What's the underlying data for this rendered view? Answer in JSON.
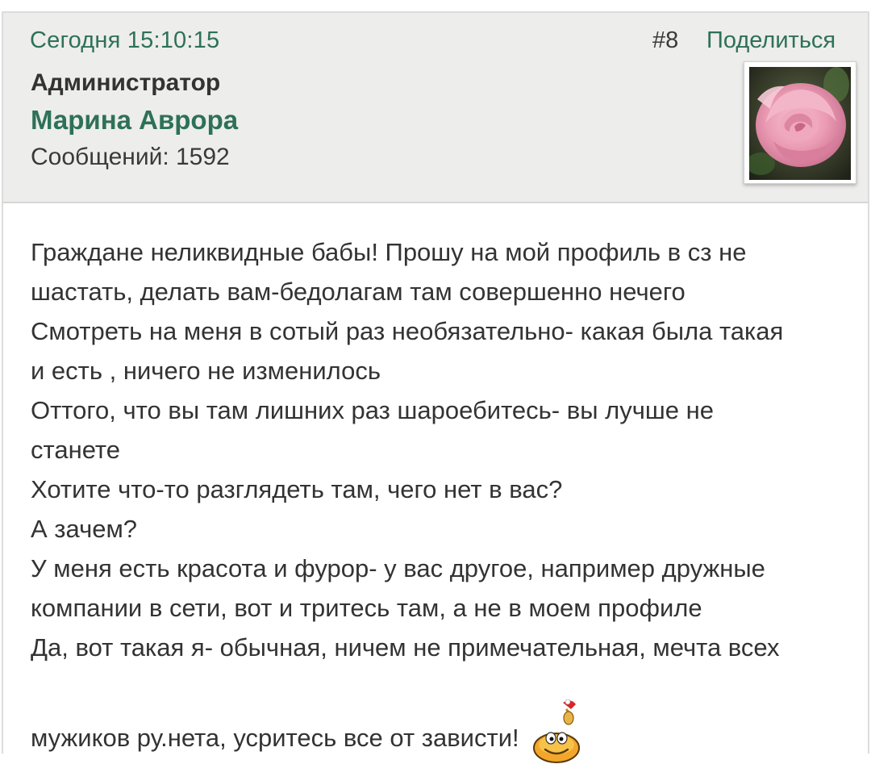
{
  "header": {
    "date": "Сегодня 15:10:15",
    "post_number": "#8",
    "share_label": "Поделиться"
  },
  "author": {
    "role": "Администратор",
    "name": "Марина Аврора",
    "messages": "Сообщений: 1592"
  },
  "body": {
    "lines": [
      "Граждане неликвидные бабы! Прошу на мой профиль в сз не",
      "шастать, делать вам-бедолагам там совершенно нечего",
      "Смотреть на меня в сотый раз необязательно- какая  была такая",
      "и есть , ничего не изменилось",
      "Оттого, что вы там лишних раз шароебитесь- вы лучше не",
      "станете",
      "Хотите что-то разглядеть там, чего нет в вас?",
      "А зачем?",
      "У меня есть красота и фурор- у вас другое, например дружные",
      "компании в сети, вот и тритесь там, а не в моем профиле",
      "Да, вот такая я- обычная, ничем не примечательная, мечта всех"
    ],
    "last_line": "мужиков ру.нета, усритесь все от зависти!"
  },
  "icons": {
    "avatar": "pink-rose-avatar",
    "emoticon": "party-smiley-icon"
  },
  "colors": {
    "link": "#2d7158",
    "header_bg": "#ededeb",
    "text": "#333333"
  }
}
